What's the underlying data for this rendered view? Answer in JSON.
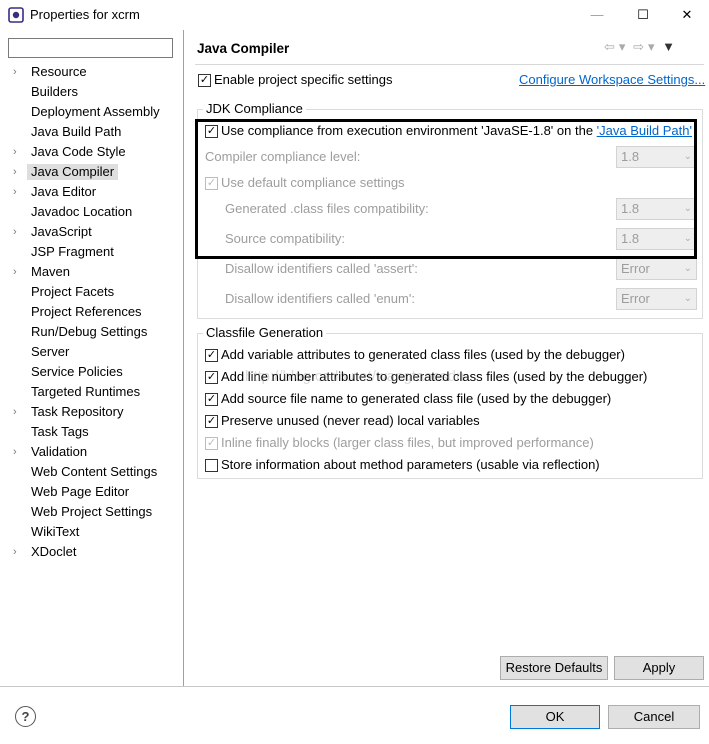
{
  "window": {
    "title": "Properties for xcrm",
    "minimize": "—",
    "maximize": "☐",
    "close": "✕"
  },
  "filter": {
    "value": "",
    "placeholder": ""
  },
  "tree": [
    {
      "label": "Resource",
      "expandable": true
    },
    {
      "label": "Builders",
      "expandable": false
    },
    {
      "label": "Deployment Assembly",
      "expandable": false
    },
    {
      "label": "Java Build Path",
      "expandable": false
    },
    {
      "label": "Java Code Style",
      "expandable": true
    },
    {
      "label": "Java Compiler",
      "expandable": true,
      "selected": true
    },
    {
      "label": "Java Editor",
      "expandable": true
    },
    {
      "label": "Javadoc Location",
      "expandable": false
    },
    {
      "label": "JavaScript",
      "expandable": true
    },
    {
      "label": "JSP Fragment",
      "expandable": false
    },
    {
      "label": "Maven",
      "expandable": true
    },
    {
      "label": "Project Facets",
      "expandable": false
    },
    {
      "label": "Project References",
      "expandable": false
    },
    {
      "label": "Run/Debug Settings",
      "expandable": false
    },
    {
      "label": "Server",
      "expandable": false
    },
    {
      "label": "Service Policies",
      "expandable": false
    },
    {
      "label": "Targeted Runtimes",
      "expandable": false
    },
    {
      "label": "Task Repository",
      "expandable": true
    },
    {
      "label": "Task Tags",
      "expandable": false
    },
    {
      "label": "Validation",
      "expandable": true
    },
    {
      "label": "Web Content Settings",
      "expandable": false
    },
    {
      "label": "Web Page Editor",
      "expandable": false
    },
    {
      "label": "Web Project Settings",
      "expandable": false
    },
    {
      "label": "WikiText",
      "expandable": false
    },
    {
      "label": "XDoclet",
      "expandable": true
    }
  ],
  "page": {
    "title": "Java Compiler",
    "nav": {
      "back": "⇦",
      "back_menu": "▾",
      "forward": "⇨",
      "forward_menu": "▾",
      "view_menu": "▼"
    },
    "enable_project_settings": {
      "label": "Enable project specific settings",
      "checked": true
    },
    "configure_workspace_link": "Configure Workspace Settings...",
    "jdk": {
      "group_label": "JDK Compliance",
      "use_compliance_prefix": "Use compliance from execution environment 'JavaSE-1.8' on the ",
      "use_compliance_link": "'Java Build Path'",
      "use_compliance_checked": true,
      "compiler_compliance_label": "Compiler compliance level:",
      "compiler_compliance_value": "1.8",
      "use_default_label": "Use default compliance settings",
      "use_default_checked": true,
      "generated_label": "Generated .class files compatibility:",
      "generated_value": "1.8",
      "source_label": "Source compatibility:",
      "source_value": "1.8",
      "assert_label": "Disallow identifiers called 'assert':",
      "assert_value": "Error",
      "enum_label": "Disallow identifiers called 'enum':",
      "enum_value": "Error"
    },
    "classfile": {
      "group_label": "Classfile Generation",
      "options": [
        {
          "label": "Add variable attributes to generated class files (used by the debugger)",
          "checked": true,
          "enabled": true
        },
        {
          "label": "Add line number attributes to generated class files (used by the debugger)",
          "checked": true,
          "enabled": true
        },
        {
          "label": "Add source file name to generated class file (used by the debugger)",
          "checked": true,
          "enabled": true
        },
        {
          "label": "Preserve unused (never read) local variables",
          "checked": true,
          "enabled": true
        },
        {
          "label": "Inline finally blocks (larger class files, but improved performance)",
          "checked": true,
          "enabled": false
        },
        {
          "label": "Store information about method parameters (usable via reflection)",
          "checked": false,
          "enabled": true
        }
      ]
    },
    "watermark": "http://blog.csdn.net/wangtaocsdn",
    "restore_defaults": "Restore Defaults",
    "apply": "Apply"
  },
  "footer": {
    "help": "?",
    "ok": "OK",
    "cancel": "Cancel"
  },
  "colors": {
    "link": "#0066cc",
    "selection": "#dedede",
    "highlight_border": "#000000",
    "default_button_border": "#0078d7"
  }
}
